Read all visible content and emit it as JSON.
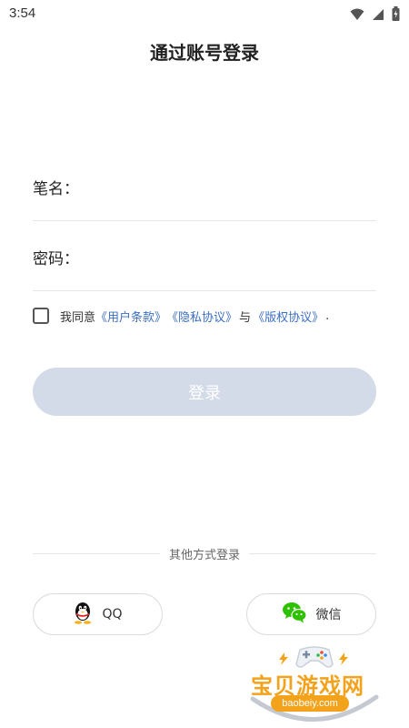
{
  "status_bar": {
    "time": "3:54"
  },
  "header": {
    "title": "通过账号登录"
  },
  "form": {
    "username_label": "笔名：",
    "password_label": "密码："
  },
  "agreement": {
    "prefix": "我同意",
    "terms": "《用户条款》",
    "privacy": "《隐私协议》",
    "conjunction": "与",
    "copyright": "《版权协议》",
    "suffix": "."
  },
  "login_button": {
    "label": "登录",
    "color": "#d3dbe9"
  },
  "other_login": {
    "divider_text": "其他方式登录",
    "qq_label": "QQ",
    "wechat_label": "微信"
  },
  "watermark": {
    "title": "宝贝游戏网",
    "url": "baobeiy.com"
  },
  "colors": {
    "link": "#3b6fc4",
    "accent": "#f3a21b"
  }
}
